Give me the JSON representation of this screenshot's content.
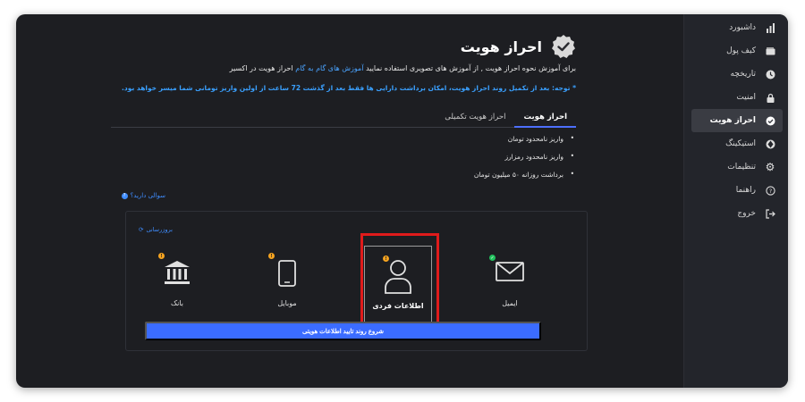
{
  "sidebar": {
    "items": [
      {
        "label": "داشبورد",
        "icon": "chart-bars-icon",
        "active": false
      },
      {
        "label": "کیف پول",
        "icon": "wallet-icon",
        "active": false
      },
      {
        "label": "تاریخچه",
        "icon": "clock-icon",
        "active": false
      },
      {
        "label": "امنیت",
        "icon": "lock-icon",
        "active": false
      },
      {
        "label": "احراز هویت",
        "icon": "check-badge-icon",
        "active": true
      },
      {
        "label": "استیکینگ",
        "icon": "staking-icon",
        "active": false
      },
      {
        "label": "تنظیمات",
        "icon": "gear-icon",
        "active": false
      },
      {
        "label": "راهنما",
        "icon": "help-icon",
        "active": false
      },
      {
        "label": "خروج",
        "icon": "logout-icon",
        "active": false
      }
    ]
  },
  "header": {
    "title": "احراز هویت",
    "intro_before": "برای آموزش نحوه احراز هویت , از آموزش های تصویری استفاده نمایید",
    "intro_link": "آموزش های گام به گام",
    "intro_after": "احراز هویت در اکسیر",
    "notice": "* توجه: بعد از تکمیل روند احراز هویت، امکان برداشت دارایی ها فقط بعد از گذشت 72 ساعت از اولین واریز تومانی شما میسر خواهد بود."
  },
  "tabs": [
    {
      "label": "احراز هویت",
      "active": true
    },
    {
      "label": "احراز هویت تکمیلی",
      "active": false
    }
  ],
  "features": [
    "واریز نامحدود تومان",
    "واریز نامحدود رمزارز",
    "برداشت روزانه ۵۰ میلیون تومان"
  ],
  "question_label": "سوالی دارید؟",
  "card": {
    "refresh_label": "بروزرسانی",
    "steps": [
      {
        "label": "ایمیل",
        "icon": "envelope-icon",
        "status": "verified"
      },
      {
        "label": "اطلاعات فردی",
        "icon": "user-icon",
        "status": "pending"
      },
      {
        "label": "موبایل",
        "icon": "mobile-icon",
        "status": "pending"
      },
      {
        "label": "بانک",
        "icon": "bank-icon",
        "status": "pending"
      }
    ],
    "start_button": "شروع روند تایید اطلاعات هویتی"
  },
  "colors": {
    "accent": "#3b6cff",
    "link": "#3aa0ff",
    "warning": "#f4a320",
    "success": "#20c05c",
    "highlight": "#e01b1b"
  }
}
